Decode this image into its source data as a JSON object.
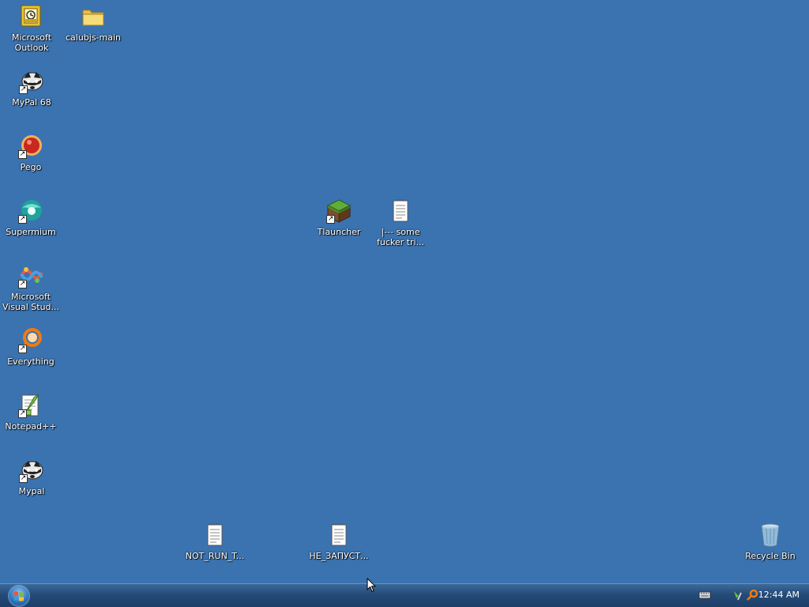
{
  "desktop": {
    "icons": {
      "outlook": "Microsoft Outlook",
      "calubjs": "calubjs-main",
      "mypal68": "MyPal 68",
      "pego": "Pego",
      "supermium": "Supermium",
      "vstudio": "Microsoft Visual Stud...",
      "everything": "Everything",
      "notepadpp": "Notepad++",
      "mypal": "Mypal",
      "tlauncher": "Tlauncher",
      "sometxt": "|--- some fucker tri...",
      "notrun": "NOT_RUN_T...",
      "nezapusk": "НЕ_ЗАПУСТ...",
      "recycle": "Recycle Bin"
    },
    "shortcut_glyph": "↗"
  },
  "taskbar": {
    "clock": "12:44 AM"
  },
  "colors": {
    "desktop": "#3a73b0",
    "taskbar": "#244b78"
  }
}
